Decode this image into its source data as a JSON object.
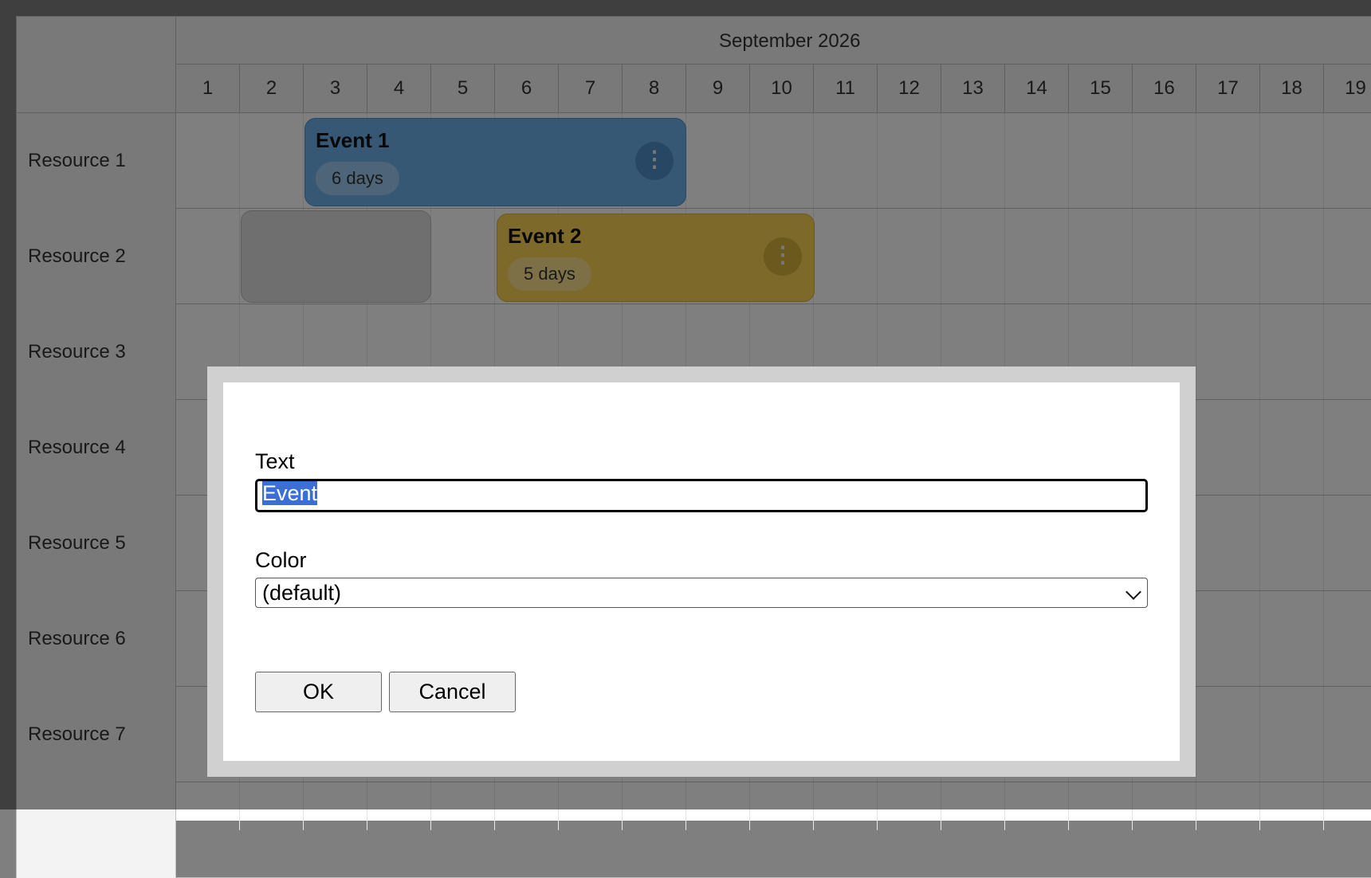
{
  "calendar": {
    "month": "September 2026",
    "days": [
      "1",
      "2",
      "3",
      "4",
      "5",
      "6",
      "7",
      "8",
      "9",
      "10",
      "11",
      "12",
      "13",
      "14",
      "15",
      "16",
      "17",
      "18",
      "19"
    ]
  },
  "resources": [
    "Resource 1",
    "Resource 2",
    "Resource 3",
    "Resource 4",
    "Resource 5",
    "Resource 6",
    "Resource 7"
  ],
  "events": [
    {
      "title": "Event 1",
      "duration": "6 days",
      "color": "#6fb0ea",
      "badge_color": "#9cc8f0",
      "menu_color": "#4f8fc8",
      "menu_icon": "kebab-icon"
    },
    {
      "title": "Event 2",
      "duration": "5 days",
      "color": "#fad353",
      "badge_color": "#fbe08d",
      "menu_color": "#d9b23a",
      "menu_icon": "kebab-icon"
    }
  ],
  "dialog": {
    "text_label": "Text",
    "text_value": "Event",
    "color_label": "Color",
    "color_value": "(default)",
    "ok_label": "OK",
    "cancel_label": "Cancel"
  },
  "colors": {
    "overlay": "rgba(0,0,0,0.5)",
    "dialog_frame": "#d0d0d0",
    "selection": "#3b6fd6"
  }
}
